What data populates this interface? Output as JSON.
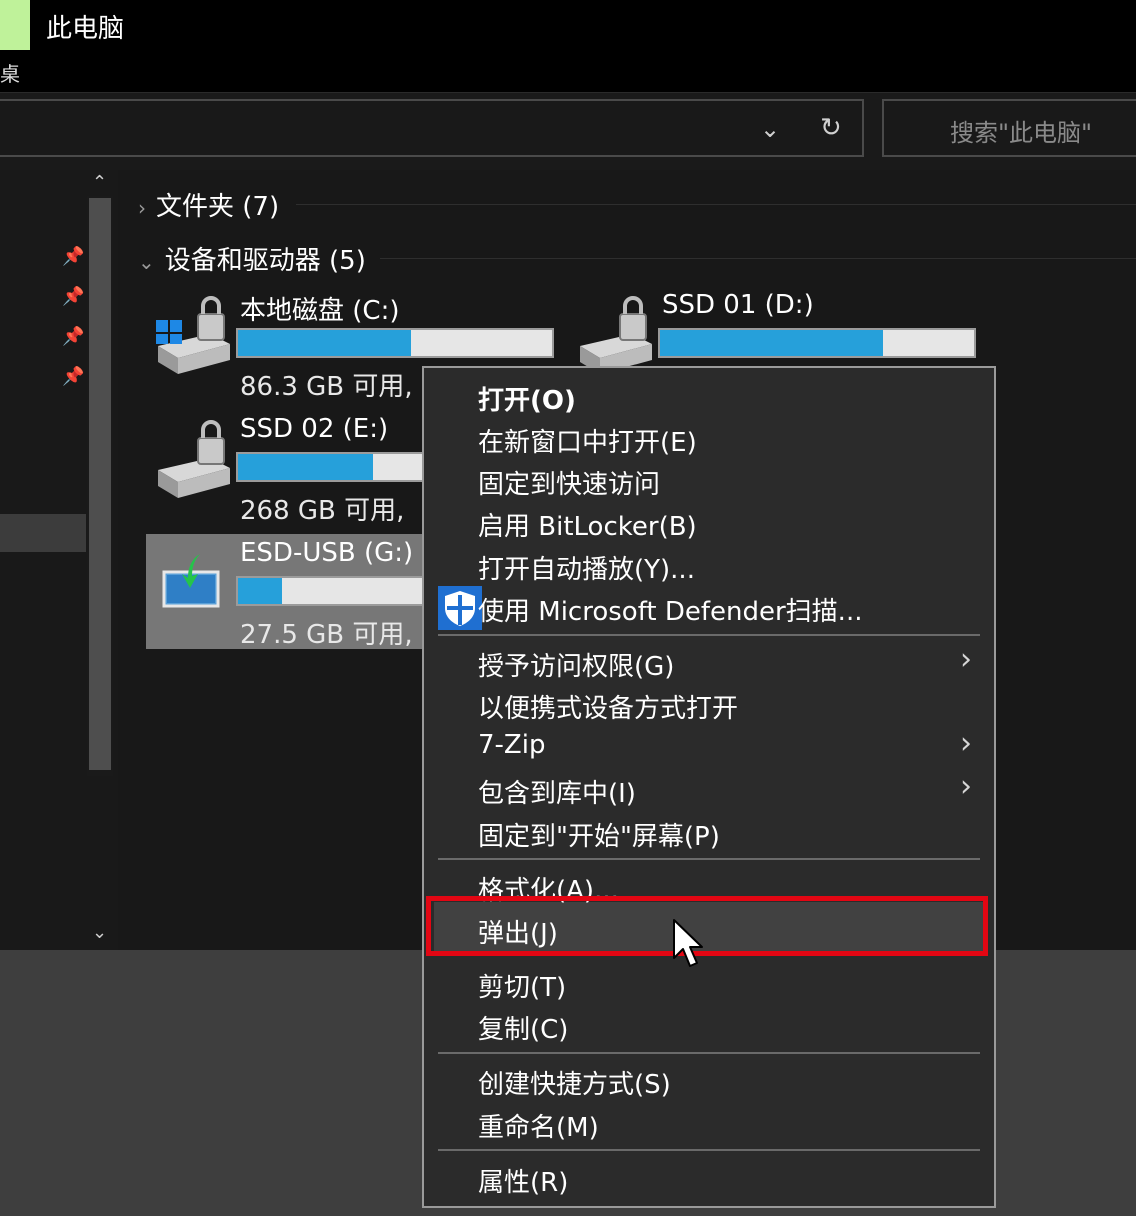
{
  "window": {
    "title": "此电脑",
    "title_fragment": "桌"
  },
  "toolbar": {
    "dropdown_icon": "chevron-down-icon",
    "refresh_icon": "refresh-icon",
    "search_placeholder": "搜索\"此电脑\""
  },
  "nav": {
    "pins": [
      "pin-icon",
      "pin-icon",
      "pin-icon",
      "pin-icon"
    ]
  },
  "groups": [
    {
      "caret": "›",
      "label": "文件夹 (7)"
    },
    {
      "caret": "⌄",
      "label": "设备和驱动器 (5)"
    }
  ],
  "drives": [
    {
      "name": "本地磁盘 (C:)",
      "free": "86.3 GB 可用,",
      "used_fraction": 0.55
    },
    {
      "name": "SSD 01 (D:)",
      "free": "",
      "used_fraction": 0.71
    },
    {
      "name": "SSD 02 (E:)",
      "free": "268 GB 可用,",
      "used_fraction": 0.43
    },
    {
      "name": "ESD-USB (G:)",
      "free": "27.5 GB 可用,",
      "used_fraction": 0.14
    }
  ],
  "context_menu": {
    "items": [
      {
        "label": "打开(O)",
        "bold": true
      },
      {
        "label": "在新窗口中打开(E)"
      },
      {
        "label": "固定到快速访问"
      },
      {
        "label": "启用 BitLocker(B)"
      },
      {
        "label": "打开自动播放(Y)..."
      },
      {
        "label": "使用 Microsoft Defender扫描...",
        "icon": "shield-icon"
      },
      {
        "label": "授予访问权限(G)",
        "submenu": true
      },
      {
        "label": "以便携式设备方式打开"
      },
      {
        "label": "7-Zip",
        "submenu": true
      },
      {
        "label": "包含到库中(I)",
        "submenu": true
      },
      {
        "label": "固定到\"开始\"屏幕(P)"
      },
      {
        "label": "格式化(A)..."
      },
      {
        "label": "弹出(J)",
        "highlighted": true
      },
      {
        "label": "剪切(T)"
      },
      {
        "label": "复制(C)"
      },
      {
        "label": "创建快捷方式(S)"
      },
      {
        "label": "重命名(M)"
      },
      {
        "label": "属性(R)"
      }
    ],
    "submenu_arrow": "›"
  },
  "colors": {
    "progress_fill": "#26a0da",
    "highlight_border": "#e30613",
    "menu_background": "#2b2b2b"
  }
}
